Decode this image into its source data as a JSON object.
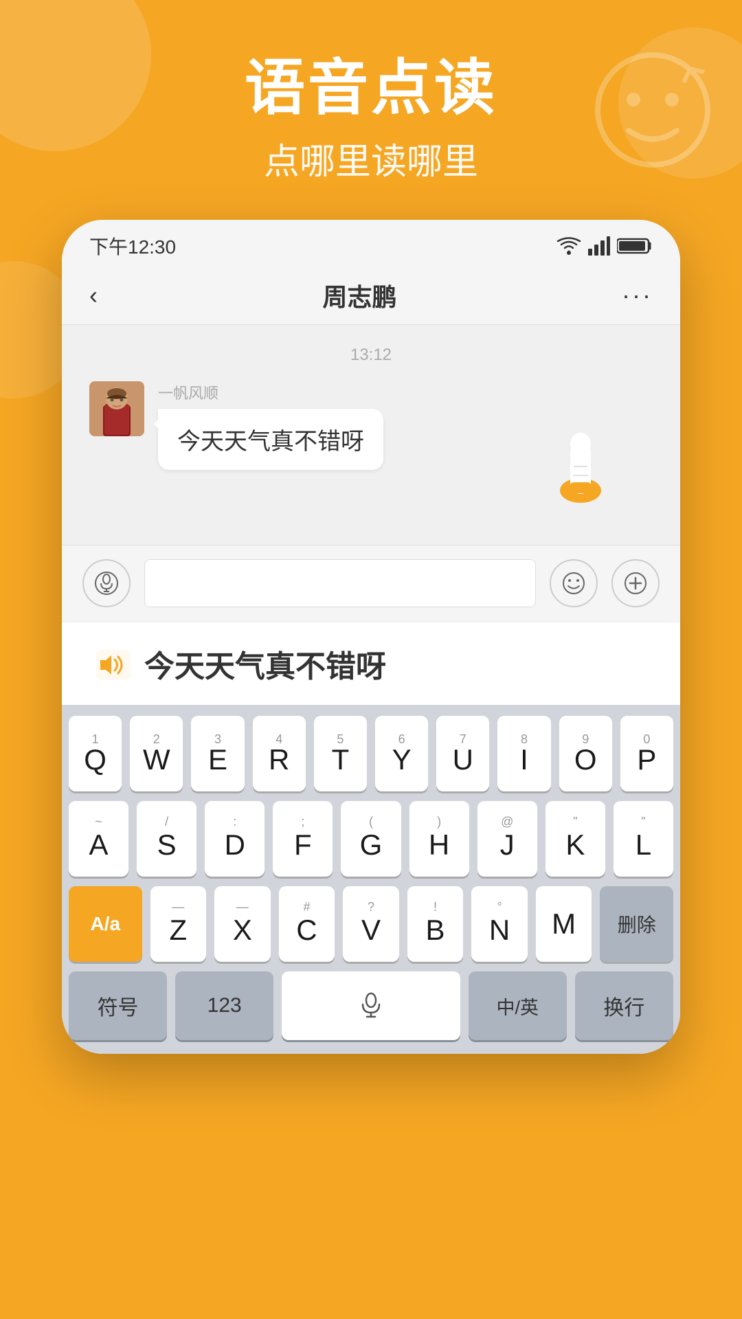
{
  "background_color": "#F5A623",
  "header": {
    "main_title": "语音点读",
    "sub_title": "点哪里读哪里"
  },
  "status_bar": {
    "time": "下午12:30",
    "wifi": "wifi",
    "signal": "signal",
    "battery": "battery"
  },
  "nav": {
    "back_label": "<",
    "title": "周志鹏",
    "more_label": "···"
  },
  "chat": {
    "timestamp": "13:12",
    "sender_name": "一帆风顺",
    "message": "今天天气真不错呀"
  },
  "highlight": {
    "text": "今天天气真不错呀",
    "icon": "🔊"
  },
  "keyboard": {
    "row1": [
      {
        "num": "1",
        "letter": "Q"
      },
      {
        "num": "2",
        "letter": "W"
      },
      {
        "num": "3",
        "letter": "E"
      },
      {
        "num": "4",
        "letter": "R"
      },
      {
        "num": "5",
        "letter": "T"
      },
      {
        "num": "6",
        "letter": "Y"
      },
      {
        "num": "7",
        "letter": "U"
      },
      {
        "num": "8",
        "letter": "I"
      },
      {
        "num": "9",
        "letter": "O"
      },
      {
        "num": "0",
        "letter": "P"
      }
    ],
    "row2": [
      {
        "sub": "~",
        "letter": "A"
      },
      {
        "sub": "/",
        "letter": "S"
      },
      {
        "sub": ":",
        "letter": "D"
      },
      {
        "sub": ":",
        "letter": "F"
      },
      {
        "sub": "(",
        "letter": "G"
      },
      {
        "sub": ")",
        "letter": "H"
      },
      {
        "sub": "@",
        "letter": "J"
      },
      {
        "sub": "\"",
        "letter": "K"
      },
      {
        "sub": "\"",
        "letter": "L"
      }
    ],
    "row3": [
      {
        "letter": "A/a",
        "type": "capslock"
      },
      {
        "sub": "—",
        "letter": "Z"
      },
      {
        "sub": "—",
        "letter": "X"
      },
      {
        "sub": "#",
        "letter": "C"
      },
      {
        "sub": "?",
        "letter": "V"
      },
      {
        "sub": "!",
        "letter": "B"
      },
      {
        "sub": "°",
        "letter": "N"
      },
      {
        "sub": "",
        "letter": "M"
      },
      {
        "letter": "删除",
        "type": "delete"
      }
    ],
    "row4": [
      {
        "label": "符号",
        "type": "func"
      },
      {
        "label": "123",
        "type": "func"
      },
      {
        "label": "mic",
        "type": "space"
      },
      {
        "label": "中/英",
        "type": "func"
      },
      {
        "label": "换行",
        "type": "func"
      }
    ]
  }
}
